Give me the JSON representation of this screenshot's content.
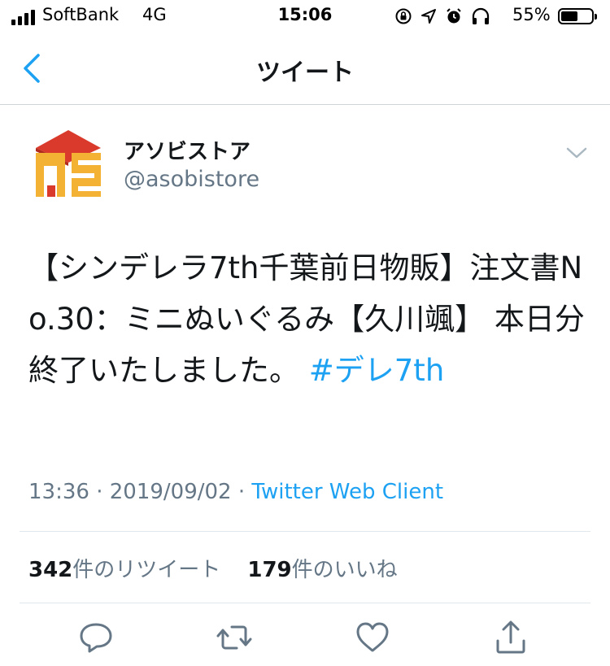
{
  "status_bar": {
    "carrier": "SoftBank",
    "network": "4G",
    "time": "15:06",
    "battery_percent": "55%",
    "battery_level": 0.55
  },
  "nav": {
    "title": "ツイート"
  },
  "tweet": {
    "author": {
      "display_name": "アソビストア",
      "handle": "@asobistore",
      "avatar_colors": {
        "roof": "#d93a2b",
        "letters": "#f3b233"
      }
    },
    "text_main": "【シンデレラ7th千葉前日物販】注文書No.30：ミニぬいぐるみ【久川颯】 本日分終了いたしました。",
    "hashtag": "#デレ7th",
    "time": "13:36",
    "separator1": " · ",
    "date": "2019/09/02",
    "separator2": " · ",
    "source": "Twitter Web Client",
    "retweets": {
      "count": "342",
      "label": "件のリツイート"
    },
    "likes": {
      "count": "179",
      "label": "件のいいね"
    }
  },
  "actions": [
    {
      "icon": "reply-icon"
    },
    {
      "icon": "retweet-icon"
    },
    {
      "icon": "like-icon"
    },
    {
      "icon": "share-icon"
    }
  ],
  "colors": {
    "accent": "#1da1f2",
    "secondary_text": "#657786",
    "primary_text": "#14171a"
  }
}
